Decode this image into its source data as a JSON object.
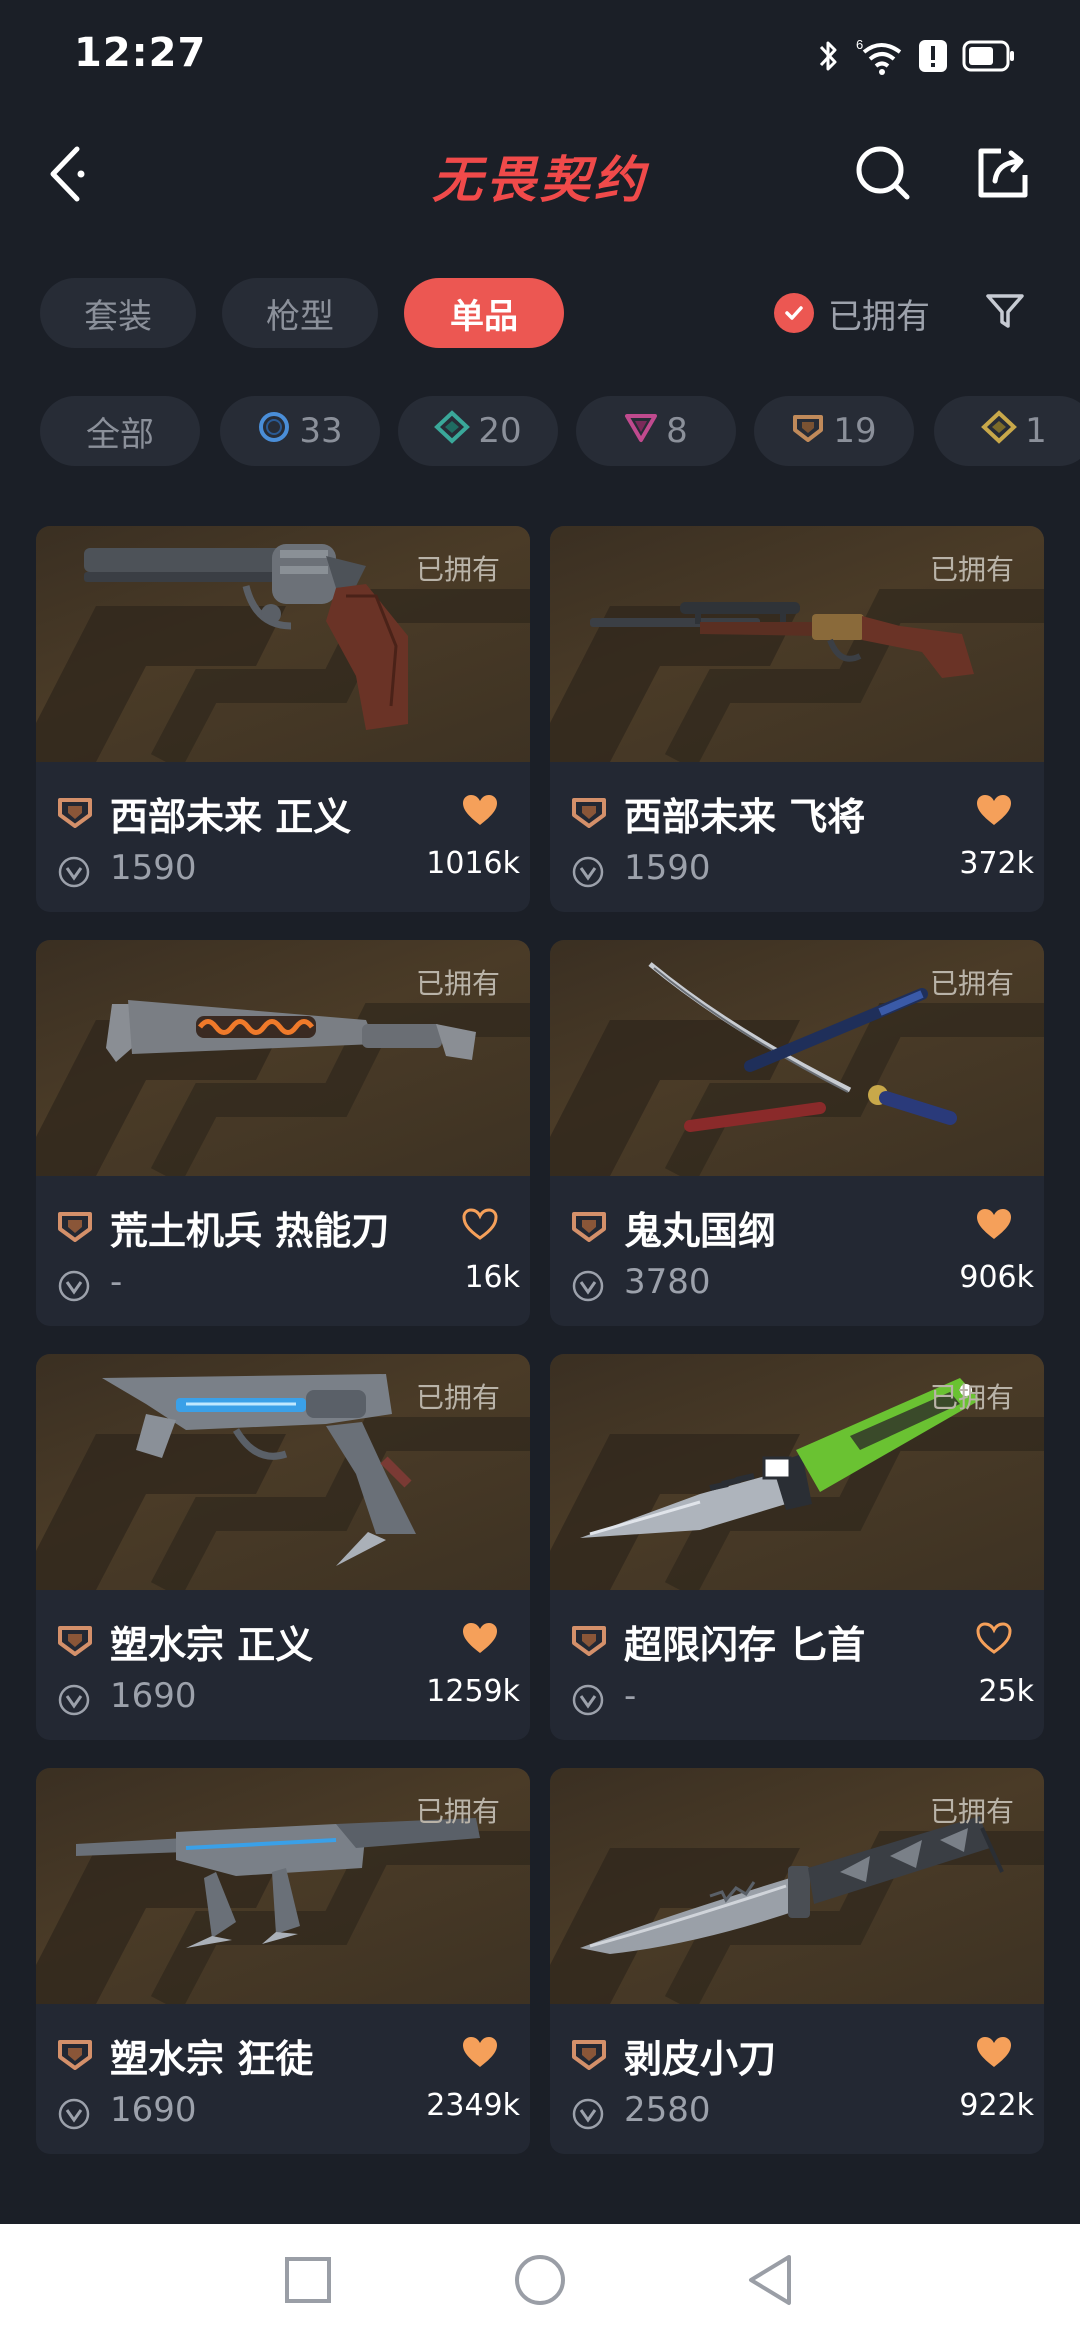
{
  "status_bar": {
    "time": "12:27"
  },
  "header": {
    "title": "无畏契约"
  },
  "tabs": [
    {
      "label": "套装",
      "active": false
    },
    {
      "label": "枪型",
      "active": false
    },
    {
      "label": "单品",
      "active": true
    }
  ],
  "owned_toggle": {
    "label": "已拥有",
    "checked": true
  },
  "rarity_filters": [
    {
      "label": "全部",
      "icon": "none",
      "color": ""
    },
    {
      "label": "33",
      "icon": "select-edition-icon",
      "color": "#4a8ed8"
    },
    {
      "label": "20",
      "icon": "deluxe-edition-icon",
      "color": "#3aa89a"
    },
    {
      "label": "8",
      "icon": "premium-edition-icon",
      "color": "#c04a8e"
    },
    {
      "label": "19",
      "icon": "exclusive-edition-icon",
      "color": "#c08a5a"
    },
    {
      "label": "1",
      "icon": "ultra-edition-icon",
      "color": "#c8a84a"
    }
  ],
  "items": [
    {
      "owned_label": "已拥有",
      "name": "西部未来 正义",
      "price": "1590",
      "likes": "1016k",
      "liked": true,
      "weapon": "revolver-image"
    },
    {
      "owned_label": "已拥有",
      "name": "西部未来 飞将",
      "price": "1590",
      "likes": "372k",
      "liked": true,
      "weapon": "rifle-image"
    },
    {
      "owned_label": "已拥有",
      "name": "荒土机兵 热能刀",
      "price": "-",
      "likes": "16k",
      "liked": false,
      "weapon": "heat-blade-image"
    },
    {
      "owned_label": "已拥有",
      "name": "鬼丸国纲",
      "price": "3780",
      "likes": "906k",
      "liked": true,
      "weapon": "katana-image"
    },
    {
      "owned_label": "已拥有",
      "name": "塑水宗 正义",
      "price": "1690",
      "likes": "1259k",
      "liked": true,
      "weapon": "pistol-image"
    },
    {
      "owned_label": "已拥有",
      "name": "超限闪存 匕首",
      "price": "-",
      "likes": "25k",
      "liked": false,
      "weapon": "dagger-image"
    },
    {
      "owned_label": "已拥有",
      "name": "塑水宗 狂徒",
      "price": "1690",
      "likes": "2349k",
      "liked": true,
      "weapon": "smg-image"
    },
    {
      "owned_label": "已拥有",
      "name": "剥皮小刀",
      "price": "2580",
      "likes": "922k",
      "liked": true,
      "weapon": "skinning-knife-image"
    }
  ],
  "colors": {
    "accent": "#ec5752",
    "heart": "#f5a05a",
    "tier": "#d4906a",
    "background": "#1b1f27",
    "card": "#232833"
  }
}
